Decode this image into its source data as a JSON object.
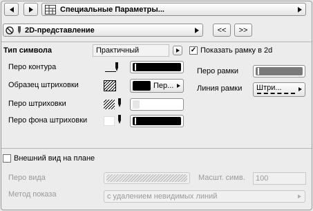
{
  "header": {
    "title": "Специальные Параметры...",
    "section": "2D-представление",
    "prev_label": "<<",
    "next_label": ">>"
  },
  "symbol_type": {
    "label": "Тип символа",
    "value": "Практичный"
  },
  "show_frame": {
    "label": "Показать рамку в 2d",
    "checked": true,
    "mark": "✓"
  },
  "left_params": [
    {
      "label": "Перо контура"
    },
    {
      "label": "Образец штриховки",
      "value": "Пер..."
    },
    {
      "label": "Перо штриховки"
    },
    {
      "label": "Перо фона штриховки"
    }
  ],
  "right_params": {
    "frame_pen_label": "Перо рамки",
    "frame_line_label": "Линия рамки",
    "frame_line_value": "Штри..."
  },
  "plan_view": {
    "label": "Внешний вид на плане",
    "checked": false,
    "view_pen_label": "Перо вида",
    "symbol_scale_label": "Масшт. симв.",
    "symbol_scale_value": "100",
    "method_label": "Метод показа",
    "method_value": "с удалением невидимых линий"
  },
  "colors": {
    "pen_black": "#000000",
    "pen_grey": "#7a7a7a",
    "disabled_text": "#9a9a9a"
  }
}
